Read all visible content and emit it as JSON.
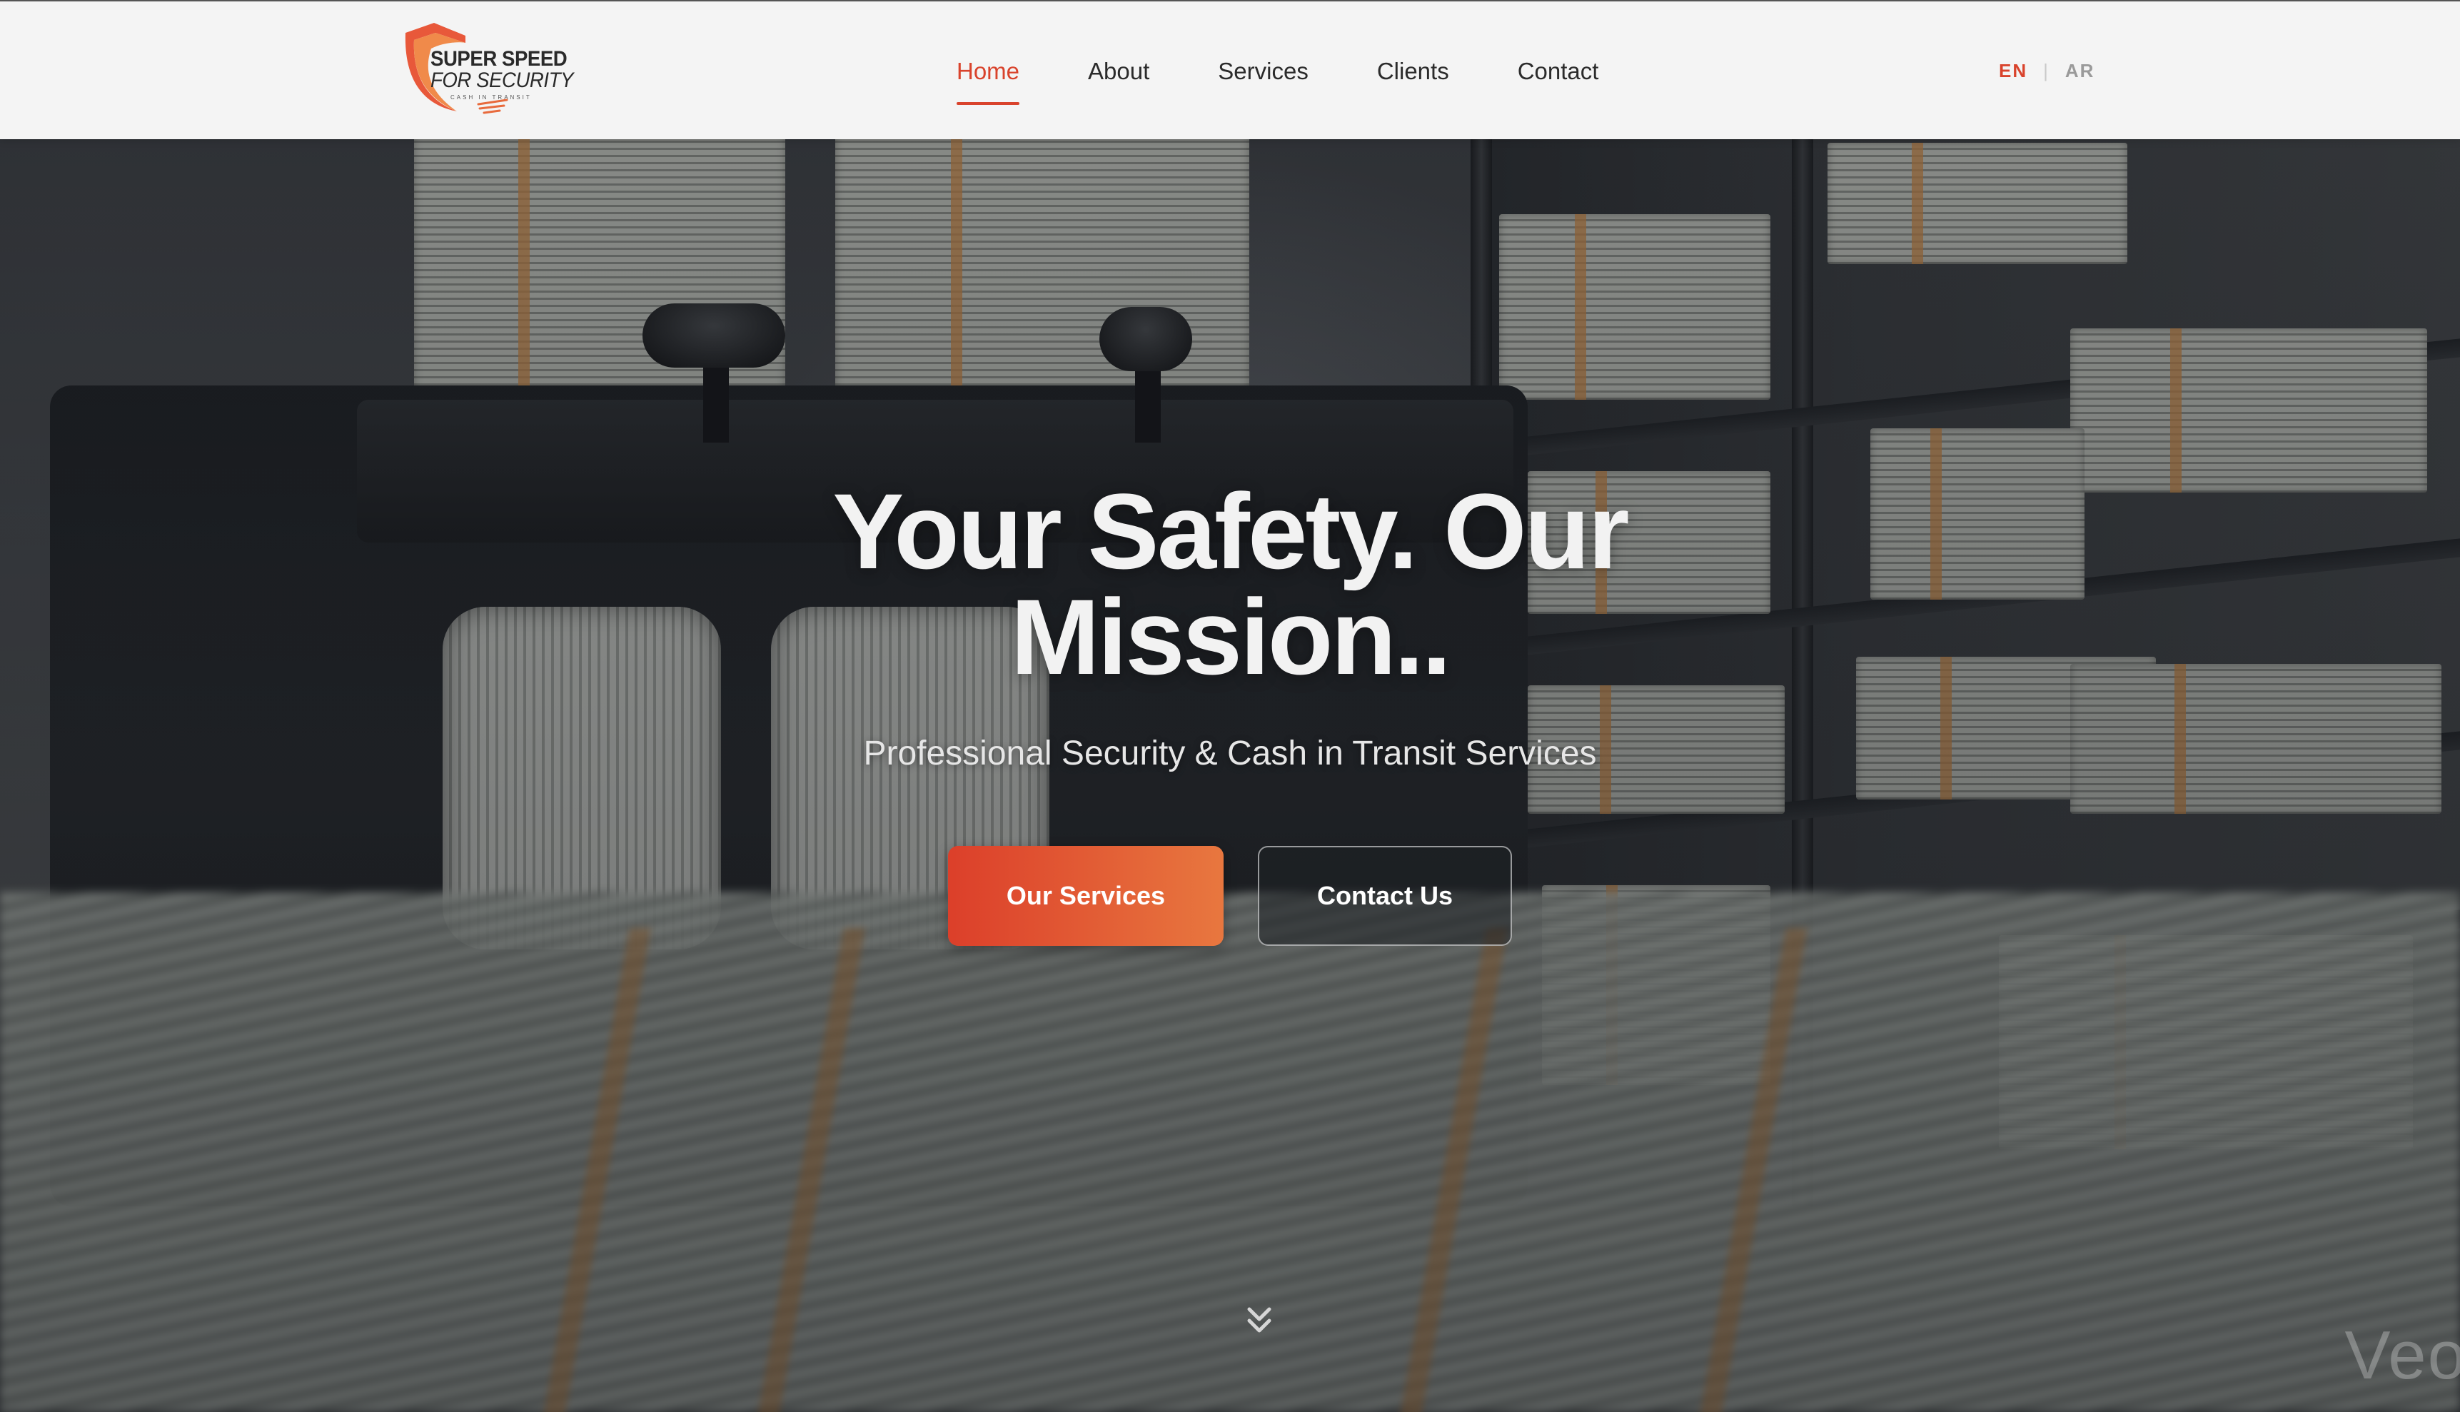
{
  "brand": {
    "logo_line1": "SUPER SPEED",
    "logo_line2": "FOR SECURITY",
    "logo_line3": "CASH IN TRANSIT",
    "accent_color": "#d9432c",
    "gradient_end_color": "#e8773f"
  },
  "nav": {
    "items": [
      {
        "label": "Home",
        "active": true
      },
      {
        "label": "About",
        "active": false
      },
      {
        "label": "Services",
        "active": false
      },
      {
        "label": "Clients",
        "active": false
      },
      {
        "label": "Contact",
        "active": false
      }
    ]
  },
  "language": {
    "en": "EN",
    "separator": "|",
    "ar": "AR",
    "selected": "EN"
  },
  "hero": {
    "title": "Your Safety. Our Mission..",
    "subtitle": "Professional Security & Cash in Transit Services",
    "primary_button": "Our Services",
    "secondary_button": "Contact Us",
    "scroll_icon": "double-chevron-down-icon",
    "watermark": "Veo"
  }
}
